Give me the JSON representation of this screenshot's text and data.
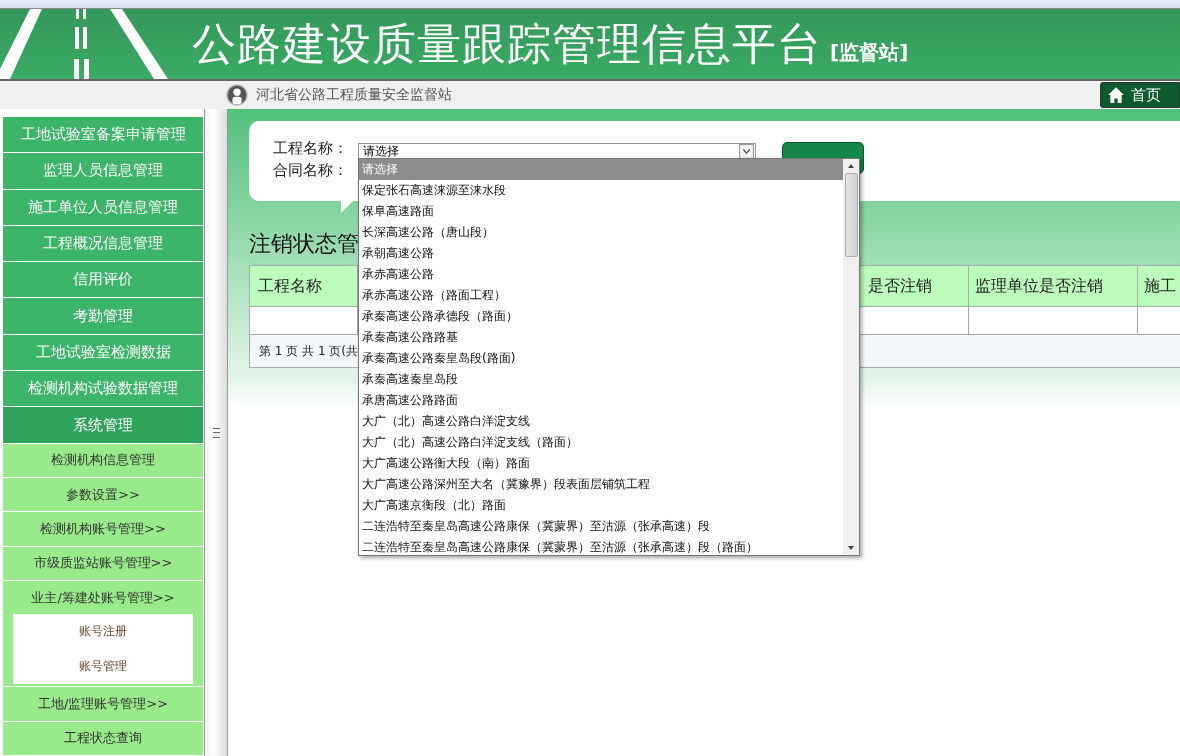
{
  "header": {
    "title": "公路建设质量跟踪管理信息平台",
    "subtitle": "[监督站]"
  },
  "user_bar": {
    "station": "河北省公路工程质量安全监督站",
    "home": "首页"
  },
  "sidebar": {
    "items": [
      {
        "label": "工地试验室备案申请管理",
        "expanded": false
      },
      {
        "label": "监理人员信息管理",
        "expanded": false
      },
      {
        "label": "施工单位人员信息管理",
        "expanded": false
      },
      {
        "label": "工程概况信息管理",
        "expanded": false
      },
      {
        "label": "信用评价",
        "expanded": false
      },
      {
        "label": "考勤管理",
        "expanded": false
      },
      {
        "label": "工地试验室检测数据",
        "expanded": false
      },
      {
        "label": "检测机构试验数据管理",
        "expanded": false
      },
      {
        "label": "系统管理",
        "expanded": true,
        "children": [
          {
            "label": "检测机构信息管理",
            "expanded": false
          },
          {
            "label": "参数设置>>",
            "expanded": false
          },
          {
            "label": "检测机构账号管理>>",
            "expanded": false
          },
          {
            "label": "市级质监站账号管理>>",
            "expanded": false
          },
          {
            "label": "业主/筹建处账号管理>>",
            "expanded": true,
            "children": [
              {
                "label": "账号注册"
              },
              {
                "label": "账号管理"
              }
            ]
          },
          {
            "label": "工地/监理账号管理>>",
            "expanded": false
          },
          {
            "label": "工程状态查询",
            "expanded": false
          }
        ]
      }
    ]
  },
  "search_form": {
    "project_label": "工程名称：",
    "project_value": "请选择",
    "contract_label": "合同名称："
  },
  "dropdown": {
    "options": [
      {
        "label": "请选择",
        "selected": true
      },
      {
        "label": "保定张石高速涞源至涞水段",
        "selected": false
      },
      {
        "label": "保阜高速路面",
        "selected": false
      },
      {
        "label": "长深高速公路（唐山段）",
        "selected": false
      },
      {
        "label": "承朝高速公路",
        "selected": false
      },
      {
        "label": "承赤高速公路",
        "selected": false
      },
      {
        "label": "承赤高速公路（路面工程）",
        "selected": false
      },
      {
        "label": "承秦高速公路承德段（路面）",
        "selected": false
      },
      {
        "label": "承秦高速公路路基",
        "selected": false
      },
      {
        "label": "承秦高速公路秦皇岛段(路面)",
        "selected": false
      },
      {
        "label": "承秦高速秦皇岛段",
        "selected": false
      },
      {
        "label": "承唐高速公路路面",
        "selected": false
      },
      {
        "label": "大广（北）高速公路白洋淀支线",
        "selected": false
      },
      {
        "label": "大广（北）高速公路白洋淀支线（路面）",
        "selected": false
      },
      {
        "label": "大广高速公路衡大段（南）路面",
        "selected": false
      },
      {
        "label": "大广高速公路深州至大名（冀豫界）段表面层铺筑工程",
        "selected": false
      },
      {
        "label": "大广高速京衡段（北）路面",
        "selected": false
      },
      {
        "label": "二连浩特至秦皇岛高速公路康保（冀蒙界）至沽源（张承高速）段",
        "selected": false
      },
      {
        "label": "二连浩特至秦皇岛高速公路康保（冀蒙界）至沽源（张承高速）段（路面）",
        "selected": false
      }
    ]
  },
  "section_title": "注销状态管",
  "table": {
    "columns": [
      "工程名称",
      "是否注销",
      "监理单位是否注销",
      "施工"
    ],
    "pager": "第 1 页 共 1 页(共"
  }
}
